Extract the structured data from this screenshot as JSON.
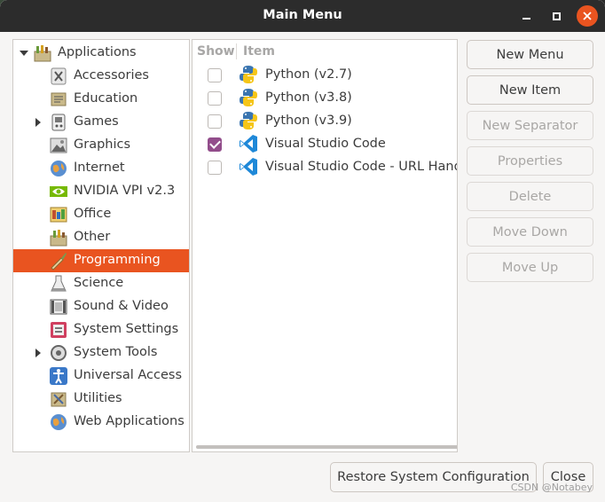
{
  "window": {
    "title": "Main Menu"
  },
  "tree": {
    "root_label": "Applications",
    "items": [
      {
        "label": "Accessories",
        "icon": "accessories-icon",
        "has_children": false,
        "selected": false
      },
      {
        "label": "Education",
        "icon": "education-icon",
        "has_children": false,
        "selected": false
      },
      {
        "label": "Games",
        "icon": "games-icon",
        "has_children": true,
        "selected": false
      },
      {
        "label": "Graphics",
        "icon": "graphics-icon",
        "has_children": false,
        "selected": false
      },
      {
        "label": "Internet",
        "icon": "internet-icon",
        "has_children": false,
        "selected": false
      },
      {
        "label": "NVIDIA VPI v2.3",
        "icon": "nvidia-icon",
        "has_children": false,
        "selected": false
      },
      {
        "label": "Office",
        "icon": "office-icon",
        "has_children": false,
        "selected": false
      },
      {
        "label": "Other",
        "icon": "other-icon",
        "has_children": false,
        "selected": false
      },
      {
        "label": "Programming",
        "icon": "programming-icon",
        "has_children": false,
        "selected": true
      },
      {
        "label": "Science",
        "icon": "science-icon",
        "has_children": false,
        "selected": false
      },
      {
        "label": "Sound & Video",
        "icon": "sound-video-icon",
        "has_children": false,
        "selected": false
      },
      {
        "label": "System Settings",
        "icon": "system-settings-icon",
        "has_children": false,
        "selected": false
      },
      {
        "label": "System Tools",
        "icon": "system-tools-icon",
        "has_children": true,
        "selected": false
      },
      {
        "label": "Universal Access",
        "icon": "universal-access-icon",
        "has_children": false,
        "selected": false
      },
      {
        "label": "Utilities",
        "icon": "utilities-icon",
        "has_children": false,
        "selected": false
      },
      {
        "label": "Web Applications",
        "icon": "web-applications-icon",
        "has_children": false,
        "selected": false
      }
    ]
  },
  "list": {
    "columns": {
      "show": "Show",
      "item": "Item"
    },
    "rows": [
      {
        "label": "Python (v2.7)",
        "checked": false,
        "icon": "python-icon"
      },
      {
        "label": "Python (v3.8)",
        "checked": false,
        "icon": "python-icon"
      },
      {
        "label": "Python (v3.9)",
        "checked": false,
        "icon": "python-icon"
      },
      {
        "label": "Visual Studio Code",
        "checked": true,
        "icon": "vscode-icon"
      },
      {
        "label": "Visual Studio Code - URL Handler",
        "checked": false,
        "icon": "vscode-icon"
      }
    ]
  },
  "buttons": {
    "new_menu": "New Menu",
    "new_item": "New Item",
    "new_separator": "New Separator",
    "properties": "Properties",
    "delete": "Delete",
    "move_down": "Move Down",
    "move_up": "Move Up",
    "restore": "Restore System Configuration",
    "close": "Close"
  },
  "watermark": "CSDN @Notabey",
  "colors": {
    "accent": "#e95420",
    "check": "#924d8b",
    "titlebar": "#2c2c2c"
  }
}
